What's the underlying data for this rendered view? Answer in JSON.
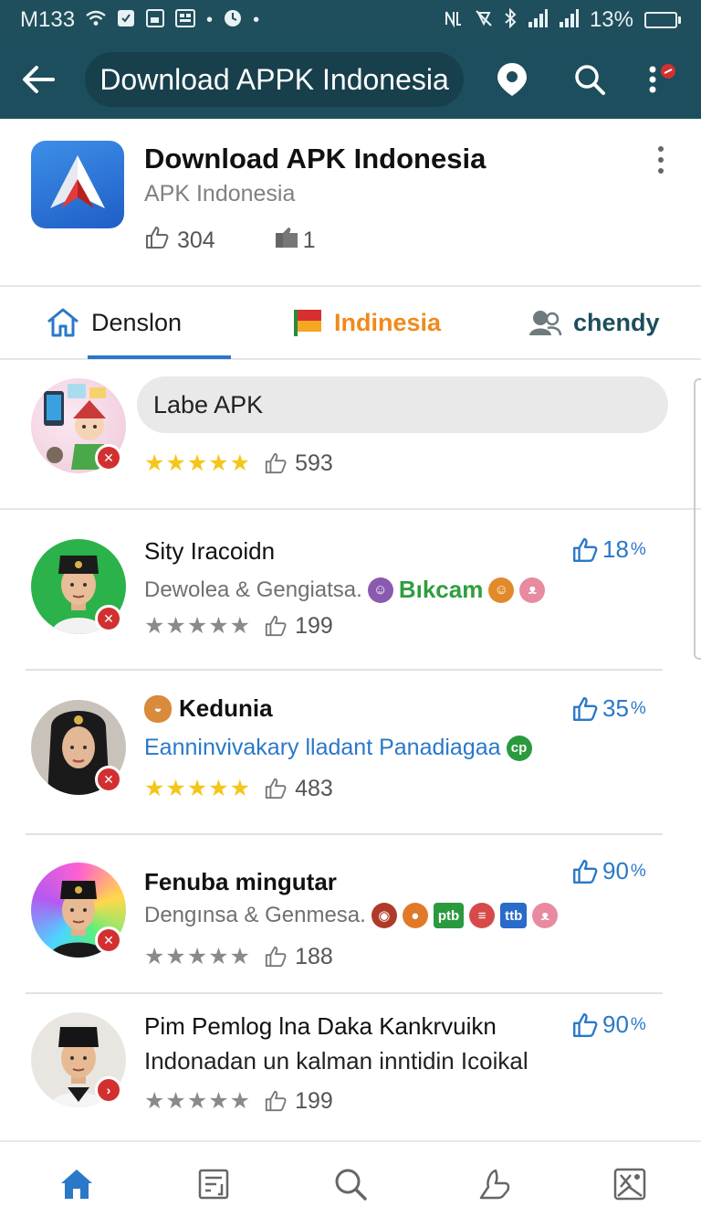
{
  "status_bar": {
    "carrier": "M133",
    "battery_percent": "13%",
    "battery_level": 0.13,
    "battery_color": "#5ad35a",
    "left_icons": [
      "wifi-icon",
      "notification-icon",
      "gallery-icon",
      "message-icon",
      "dot-icon",
      "clock-icon",
      "dot-icon"
    ],
    "right_icons": [
      "nfc-icon",
      "mute-icon",
      "bluetooth-icon",
      "signal-icon",
      "signal-icon",
      "battery-icon"
    ]
  },
  "app_bar": {
    "background": "#1d4e5d",
    "search_text": "Download APPK Indonesia",
    "icons": [
      "back-arrow-icon",
      "location-pin-icon",
      "search-icon",
      "more-vert-icon"
    ]
  },
  "app_header": {
    "title": "Download APK Indonesia",
    "developer": "APK Indonesia",
    "likes": "304",
    "dislikes": "1",
    "icon": "paper-plane-logo-icon"
  },
  "tabs": [
    {
      "label": "Denslon",
      "icon": "home-icon",
      "active": true
    },
    {
      "label": "Indinesia",
      "icon": "flag-icon",
      "active": false
    },
    {
      "label": "chendy",
      "icon": "people-icon",
      "active": false
    }
  ],
  "featured": {
    "label": "Labe APK",
    "rating_stars": 5,
    "likes": "593"
  },
  "items": [
    {
      "title": "Sity Iracoidn",
      "subtitle": "Dewolea & Gengiatsa.",
      "subtitle_badge": "Bıkcam",
      "rating_stars": 5,
      "stars_color": "grey",
      "likes": "199",
      "percent": "18",
      "percent_unit": "%",
      "avatar_bg": "#2bb24a"
    },
    {
      "title": "Kedunia",
      "subtitle": "Eanninvivakary lladant Panadiagaa",
      "subtitle_badge": "cp",
      "rating_stars": 5,
      "stars_color": "gold",
      "likes": "483",
      "percent": "35",
      "percent_unit": "%",
      "avatar_bg": "#c9c2bb"
    },
    {
      "title": "Fenuba mingutar",
      "subtitle": "Dengınsa & Genmesa.",
      "subtitle_badges": [
        "ptb",
        "ttb"
      ],
      "rating_stars": 5,
      "stars_color": "grey",
      "likes": "188",
      "percent": "90",
      "percent_unit": "%",
      "avatar_bg": "#b46ad6"
    },
    {
      "title": "Pim Pemlog lna Daka Kankrvuikn",
      "subtitle": "Indonadan un kalman inntidin Icoikal",
      "rating_stars": 5,
      "stars_color": "grey",
      "likes": "199",
      "percent": "90",
      "percent_unit": "%",
      "avatar_bg": "#e9e6e1"
    }
  ],
  "bottom_nav": [
    "home-icon",
    "news-icon",
    "search-icon",
    "thumbs-icon",
    "gallery-icon"
  ],
  "colors": {
    "accent_blue": "#2a78c8",
    "orange": "#f08a1c",
    "teal_dark": "#1c4e5c",
    "star_gold": "#f5c518",
    "badge_red": "#d23030"
  }
}
